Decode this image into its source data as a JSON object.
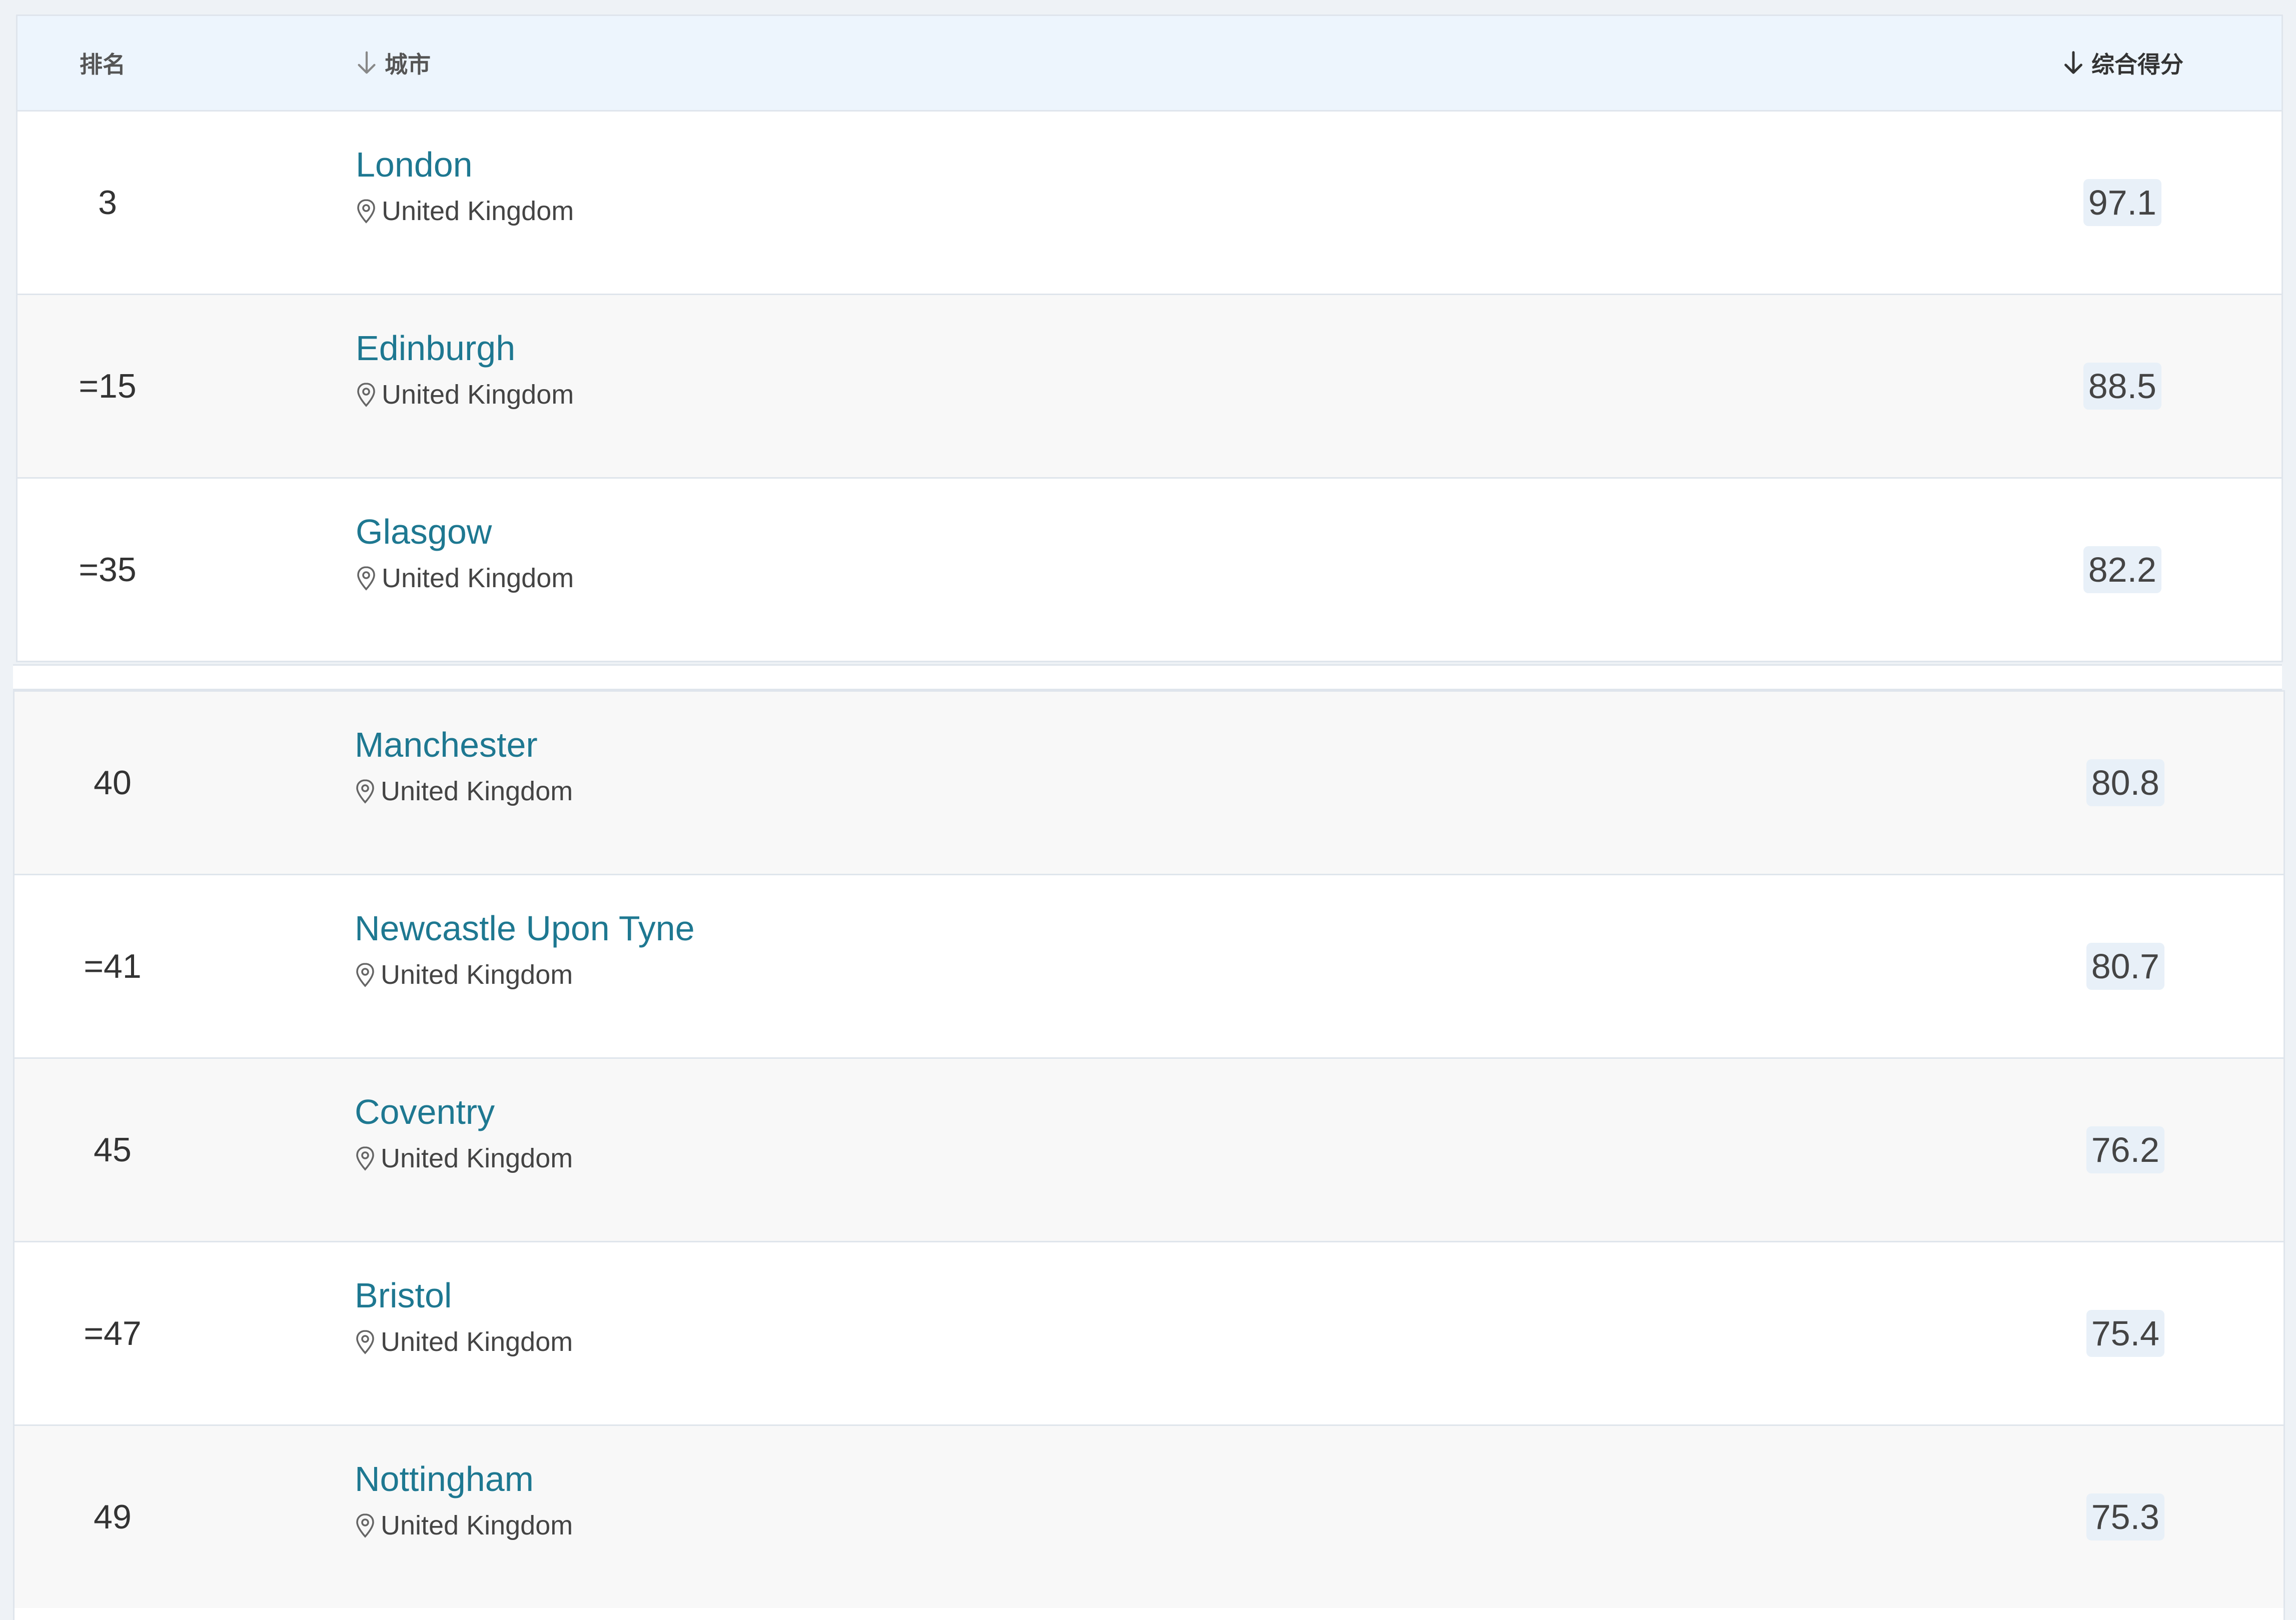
{
  "table": {
    "headers": {
      "rank": "排名",
      "city": "城市",
      "score": "综合得分"
    },
    "rows_top": [
      {
        "rank": "3",
        "city": "London",
        "country": "United Kingdom",
        "score": "97.1"
      },
      {
        "rank": "=15",
        "city": "Edinburgh",
        "country": "United Kingdom",
        "score": "88.5"
      },
      {
        "rank": "=35",
        "city": "Glasgow",
        "country": "United Kingdom",
        "score": "82.2"
      }
    ],
    "rows_bottom": [
      {
        "rank": "40",
        "city": "Manchester",
        "country": "United Kingdom",
        "score": "80.8"
      },
      {
        "rank": "=41",
        "city": "Newcastle Upon Tyne",
        "country": "United Kingdom",
        "score": "80.7"
      },
      {
        "rank": "45",
        "city": "Coventry",
        "country": "United Kingdom",
        "score": "76.2"
      },
      {
        "rank": "=47",
        "city": "Bristol",
        "country": "United Kingdom",
        "score": "75.4"
      },
      {
        "rank": "49",
        "city": "Nottingham",
        "country": "United Kingdom",
        "score": "75.3"
      }
    ]
  },
  "colors": {
    "link": "#1e7891",
    "header_bg": "#edf5fd",
    "score_badge_bg": "#e8f0f8"
  },
  "icons": {
    "sort": "arrow-down-icon",
    "location": "map-pin-icon"
  }
}
